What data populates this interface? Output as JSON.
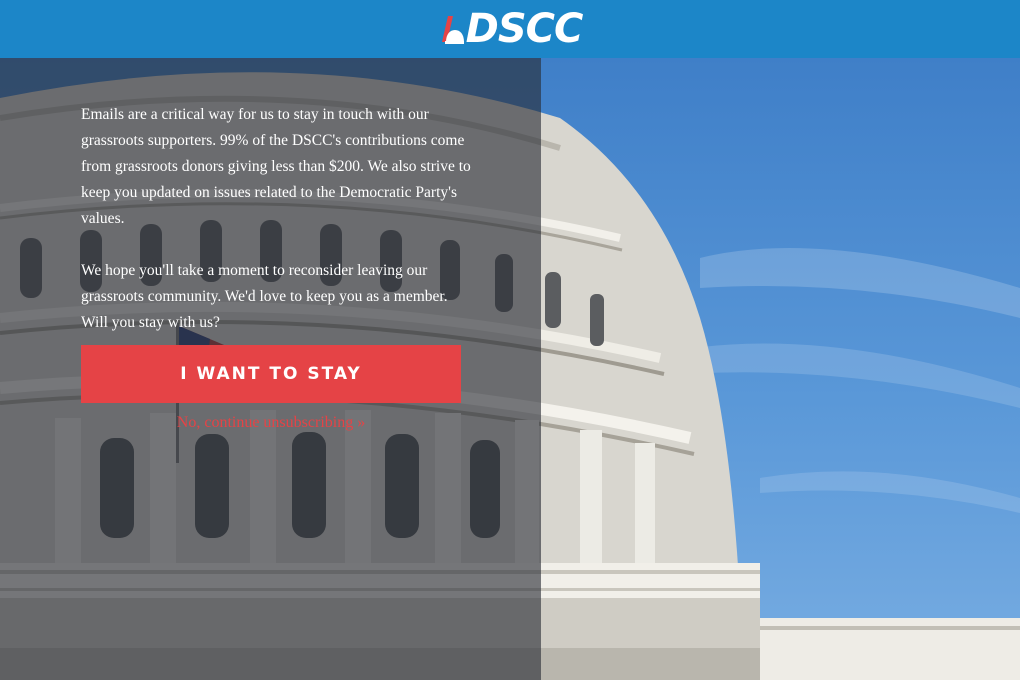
{
  "header": {
    "logo_text": "DSCC",
    "logo_mark_text": "DSCC",
    "logo_icon": "capitol-flag-icon"
  },
  "main": {
    "paragraphs": [
      "Emails are a critical way for us to stay in touch with our grassroots supporters. 99% of the DSCC's contributions come from grassroots donors giving less than $200. We also strive to keep you updated on issues related to the Democratic Party's values.",
      "We hope you'll take a moment to reconsider leaving our grassroots community. We'd love to keep you as a member. Will you stay with us?"
    ],
    "stay_button_label": "I WANT TO STAY",
    "unsubscribe_link_label": "No, continue unsubscribing »"
  },
  "colors": {
    "header_bg": "#1c86c8",
    "button_bg": "#e54346",
    "link": "#e54346",
    "overlay": "rgba(40,44,52,0.62)"
  },
  "background_image": "us-capitol-dome"
}
